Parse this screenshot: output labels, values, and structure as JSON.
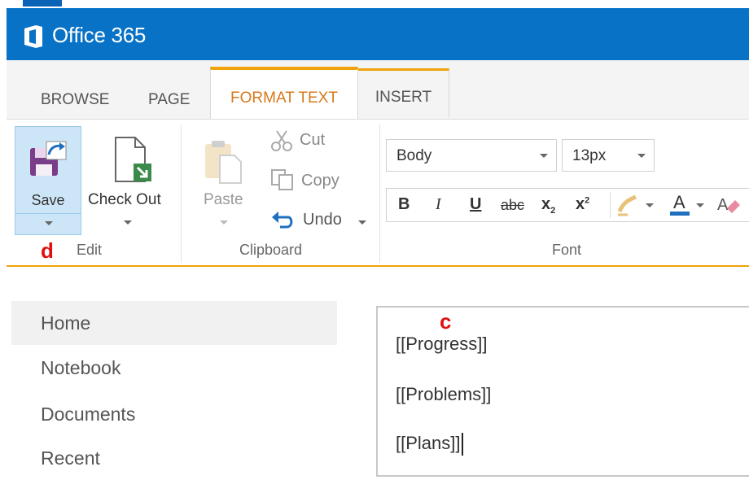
{
  "suite": {
    "brand": "Office 365",
    "logo_icon": "office-logo-icon",
    "color": "#0872c6"
  },
  "ribbon_tabs": [
    {
      "label": "BROWSE",
      "active": false
    },
    {
      "label": "PAGE",
      "active": false
    },
    {
      "label": "FORMAT TEXT",
      "active": true
    },
    {
      "label": "INSERT",
      "active": false
    }
  ],
  "groups": {
    "edit": {
      "label": "Edit",
      "save_label": "Save",
      "checkout_label": "Check Out"
    },
    "clipboard": {
      "label": "Clipboard",
      "paste_label": "Paste",
      "cut_label": "Cut",
      "copy_label": "Copy",
      "undo_label": "Undo"
    },
    "font": {
      "label": "Font",
      "style_value": "Body",
      "size_value": "13px",
      "buttons": {
        "bold": "B",
        "italic": "I",
        "underline": "U",
        "strike": "abc",
        "subscript": "x",
        "superscript": "x"
      }
    }
  },
  "annotations": {
    "d": "d",
    "c": "c"
  },
  "nav": [
    {
      "label": "Home",
      "active": true
    },
    {
      "label": "Notebook",
      "active": false
    },
    {
      "label": "Documents",
      "active": false
    },
    {
      "label": "Recent",
      "active": false
    }
  ],
  "editor": {
    "lines": [
      "[[Progress]]",
      "[[Problems]]",
      "[[Plans]]"
    ]
  },
  "colors": {
    "accent": "#f0a30a",
    "active_tab_text": "#d7781a",
    "annotation": "#e01010"
  }
}
